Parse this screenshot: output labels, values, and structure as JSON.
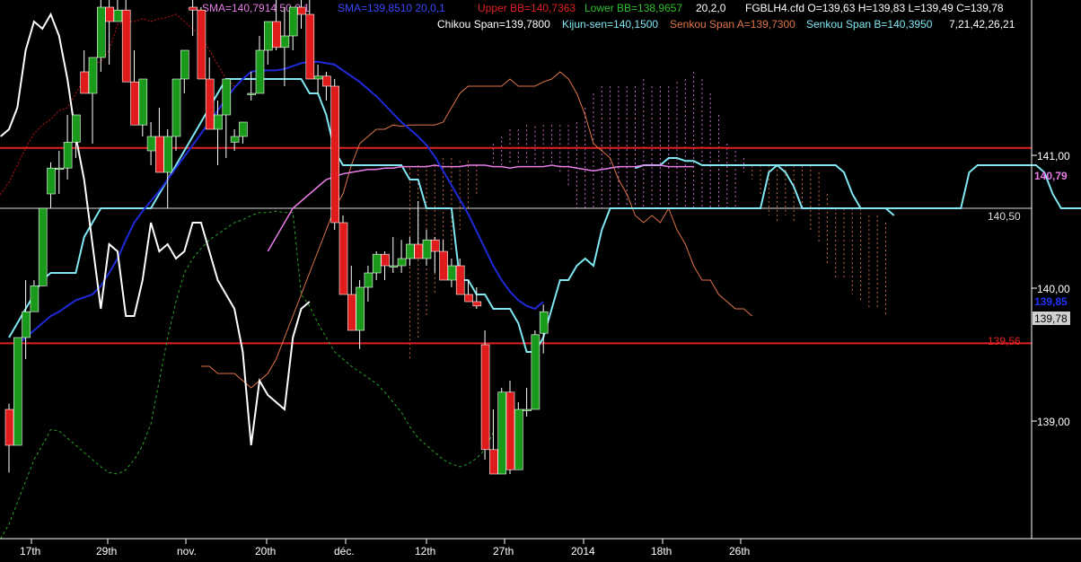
{
  "colors": {
    "background": "#000000",
    "up_candle": "#1a9a1a",
    "down_candle": "#e01b1b",
    "sma50": "#e87de8",
    "sma20": "#1f2ad8",
    "bb_upper": "#c21313",
    "bb_lower": "#2aa52a",
    "chikou": "#ffffff",
    "kijun": "#7fe8f2",
    "senkou_a": "#e0744a",
    "senkou_b": "#7fe8f2",
    "hline_red": "#e32020",
    "hline_white": "#dddddd",
    "axis_text": "#ffffff"
  },
  "header": {
    "sma50_text": "SMA=140,7914  50,0,1",
    "sma20_text": "SMA=139,8510  20,0,1",
    "bb_upper_text": "Upper BB=140,7363",
    "bb_lower_text": "Lower BB=138,9657",
    "bb_params_text": "20,2,0",
    "ohlc_text": "FGBLH4.cfd O=139,63 H=139,83 L=139,49 C=139,78",
    "chikou_text": "Chikou Span=139,7800",
    "kijun_text": "Kijun-sen=140,1500",
    "senkou_a_text": "Senkou Span A=139,7300",
    "senkou_b_text": "Senkou Span B=140,3950",
    "ichimoku_params_text": "7,21,42,26,21"
  },
  "chart_data": {
    "type": "candlestick",
    "ylim": [
      138.2,
      141.95
    ],
    "grid": false,
    "y_ticks": [
      "141,00",
      "140,50",
      "140,00",
      "139,00"
    ],
    "x_ticks": [
      "17th",
      "29th",
      "nov.",
      "20th",
      "déc.",
      "12th",
      "27th",
      "2014",
      "18th",
      "26th"
    ],
    "price_labels": {
      "sma50": "140,79",
      "white_line": "140,50",
      "sma20": "139,85",
      "last_close": "139,78",
      "red_line": "139,56"
    },
    "horizontal_lines": {
      "red_upper": 140.92,
      "white": 140.5,
      "red_lower": 139.56
    },
    "candles": [
      [
        139.1,
        139.14,
        138.66,
        138.85
      ],
      [
        138.85,
        139.6,
        138.85,
        139.6
      ],
      [
        139.6,
        140.0,
        139.45,
        139.78
      ],
      [
        139.78,
        140.0,
        139.78,
        139.96
      ],
      [
        139.96,
        140.5,
        139.96,
        140.5
      ],
      [
        140.6,
        140.82,
        140.5,
        140.78
      ],
      [
        140.78,
        140.9,
        140.6,
        140.78
      ],
      [
        140.78,
        141.15,
        140.7,
        140.96
      ],
      [
        140.96,
        141.15,
        140.85,
        141.15
      ],
      [
        141.45,
        141.6,
        141.3,
        141.3
      ],
      [
        141.3,
        141.5,
        140.95,
        141.55
      ],
      [
        141.55,
        141.95,
        141.45,
        141.9
      ],
      [
        141.9,
        141.98,
        141.5,
        141.8
      ],
      [
        141.8,
        141.95,
        141.8,
        141.88
      ],
      [
        141.88,
        141.95,
        141.38,
        141.38
      ],
      [
        141.38,
        141.6,
        141.08,
        141.08
      ],
      [
        141.08,
        141.4,
        141.0,
        141.4
      ],
      [
        140.9,
        141.1,
        140.8,
        141.0
      ],
      [
        141.0,
        141.2,
        140.75,
        140.75
      ],
      [
        140.75,
        141.05,
        140.5,
        141.0
      ],
      [
        141.0,
        141.4,
        140.9,
        141.4
      ],
      [
        141.4,
        141.6,
        141.3,
        141.6
      ],
      [
        141.9,
        141.95,
        141.7,
        141.88
      ],
      [
        141.88,
        141.9,
        141.4,
        141.4
      ],
      [
        141.4,
        141.55,
        141.05,
        141.05
      ],
      [
        141.05,
        141.25,
        140.8,
        141.15
      ],
      [
        141.15,
        141.4,
        140.85,
        141.4
      ],
      [
        140.96,
        141.05,
        140.9,
        141.0
      ],
      [
        141.0,
        141.1,
        140.95,
        141.1
      ],
      [
        141.3,
        141.45,
        141.25,
        141.3
      ],
      [
        141.3,
        141.7,
        141.3,
        141.6
      ],
      [
        141.6,
        141.8,
        141.5,
        141.8
      ],
      [
        141.8,
        141.95,
        141.6,
        141.62
      ],
      [
        141.62,
        141.9,
        141.35,
        141.7
      ],
      [
        141.7,
        141.9,
        141.6,
        141.9
      ],
      [
        141.9,
        141.95,
        141.75,
        141.85
      ],
      [
        141.85,
        141.95,
        141.4,
        141.4
      ],
      [
        141.4,
        141.5,
        141.3,
        141.42
      ],
      [
        141.42,
        141.45,
        141.25,
        141.35
      ],
      [
        141.35,
        141.4,
        140.35,
        140.4
      ],
      [
        140.4,
        140.45,
        139.9,
        139.9
      ],
      [
        139.9,
        140.1,
        139.65,
        139.65
      ],
      [
        139.65,
        140.0,
        139.52,
        139.95
      ],
      [
        139.95,
        140.1,
        139.85,
        140.05
      ],
      [
        140.05,
        140.2,
        140.0,
        140.18
      ],
      [
        140.18,
        140.2,
        140.0,
        140.1
      ],
      [
        140.1,
        140.3,
        140.05,
        140.1
      ],
      [
        140.1,
        140.28,
        140.05,
        140.15
      ],
      [
        140.15,
        140.3,
        140.1,
        140.25
      ],
      [
        140.25,
        140.55,
        140.15,
        140.15
      ],
      [
        140.15,
        140.35,
        140.1,
        140.28
      ],
      [
        140.28,
        140.3,
        140.05,
        140.2
      ],
      [
        140.2,
        140.28,
        140.0,
        140.0
      ],
      [
        140.0,
        140.15,
        139.95,
        140.1
      ],
      [
        140.1,
        140.15,
        139.9,
        139.9
      ],
      [
        139.9,
        140.0,
        139.85,
        139.85
      ],
      [
        139.85,
        139.95,
        139.8,
        139.82
      ],
      [
        139.55,
        139.65,
        138.75,
        138.82
      ],
      [
        138.82,
        139.1,
        138.65,
        138.65
      ],
      [
        138.65,
        139.25,
        138.65,
        139.22
      ],
      [
        139.22,
        139.3,
        138.65,
        138.68
      ],
      [
        138.68,
        139.15,
        138.68,
        139.1
      ],
      [
        139.1,
        139.25,
        139.05,
        139.1
      ],
      [
        139.1,
        139.65,
        139.1,
        139.62
      ],
      [
        139.63,
        139.83,
        139.49,
        139.78
      ]
    ],
    "series": [
      {
        "key": "chikou",
        "values": [
          141.0,
          141.05,
          141.2,
          141.6,
          141.8,
          141.75,
          141.85,
          141.7,
          141.4,
          141.0,
          140.7,
          140.25,
          139.8,
          140.25,
          140.2,
          139.75,
          139.75,
          140.0,
          140.4,
          140.2,
          140.25,
          140.15,
          140.2,
          140.4,
          140.4,
          140.2,
          140.0,
          139.9,
          139.8,
          139.5,
          138.85,
          139.3,
          139.2,
          139.15,
          139.1,
          139.6,
          139.8,
          139.85
        ]
      },
      {
        "key": "sma50",
        "values": [
          140.2,
          140.3,
          140.4,
          140.5,
          140.55,
          140.6,
          140.65,
          140.7,
          140.72,
          140.74,
          140.75,
          140.76,
          140.77,
          140.77,
          140.78,
          140.78,
          140.79,
          140.79,
          140.79,
          140.79,
          140.8,
          140.79,
          140.79,
          140.79,
          140.8,
          140.8,
          140.8,
          140.79,
          140.79,
          140.78,
          140.79,
          140.79,
          140.79,
          140.79,
          140.8,
          140.79,
          140.79,
          140.78,
          140.77,
          140.76,
          140.77,
          140.78,
          140.79,
          140.79,
          140.79,
          140.8,
          140.8,
          140.8,
          140.79,
          140.79,
          140.79,
          140.79
        ]
      },
      {
        "key": "sma20",
        "values": [
          139.55,
          139.6,
          139.65,
          139.7,
          139.75,
          139.78,
          139.82,
          139.86,
          139.88,
          139.9,
          139.96,
          140.05,
          140.15,
          140.28,
          140.4,
          140.48,
          140.55,
          140.62,
          140.7,
          140.78,
          140.86,
          140.94,
          141.02,
          141.1,
          141.18,
          141.26,
          141.34,
          141.4,
          141.45,
          141.46,
          141.46,
          141.46,
          141.47,
          141.49,
          141.51,
          141.52,
          141.52,
          141.51,
          141.5,
          141.46,
          141.42,
          141.38,
          141.33,
          141.28,
          141.22,
          141.16,
          141.1,
          141.05,
          141.0,
          140.94,
          140.86,
          140.76,
          140.66,
          140.56,
          140.46,
          140.34,
          140.22,
          140.1,
          140.0,
          139.92,
          139.86,
          139.82,
          139.8,
          139.85
        ]
      },
      {
        "key": "bb_upper",
        "values": [
          140.8,
          140.72,
          140.66,
          140.6,
          140.6,
          140.55,
          140.52,
          140.5,
          140.55,
          140.6,
          140.68,
          140.8,
          140.92,
          141.02,
          141.08,
          141.12,
          141.18,
          141.2,
          141.3,
          141.4,
          141.5,
          141.52,
          141.6,
          141.78,
          141.8,
          141.8,
          141.82,
          141.8,
          141.82,
          141.83,
          141.85,
          141.8,
          141.75,
          141.7,
          141.6,
          141.5,
          141.4,
          141.35
        ]
      },
      {
        "key": "bb_lower",
        "values": [
          138.2,
          138.3,
          138.45,
          138.6,
          138.75,
          138.85,
          138.96,
          138.95,
          138.9,
          138.85,
          138.8,
          138.75,
          138.7,
          138.66,
          138.65,
          138.68,
          138.75,
          138.85,
          139.0,
          139.3,
          139.6,
          139.85,
          140.05,
          140.15,
          140.22,
          140.28,
          140.32,
          140.36,
          140.4,
          140.42,
          140.45,
          140.47,
          140.47,
          140.48,
          140.47,
          140.47,
          139.9,
          139.82,
          139.7,
          139.6,
          139.5,
          139.45,
          139.4,
          139.36,
          139.32,
          139.28,
          139.22,
          139.15,
          139.08,
          138.98,
          138.9,
          138.85,
          138.8,
          138.75,
          138.72,
          138.7,
          138.72,
          138.76,
          138.82,
          138.94
        ]
      },
      {
        "key": "kijun",
        "values": [
          139.6,
          139.7,
          139.8,
          139.9,
          140.0,
          140.05,
          140.05,
          140.05,
          140.05,
          140.3,
          140.4,
          140.5,
          140.5,
          140.5,
          140.5,
          140.5,
          140.5,
          140.5,
          140.6,
          140.7,
          140.8,
          140.9,
          141.0,
          141.1,
          141.2,
          141.3,
          141.4,
          141.4,
          141.4,
          141.4,
          141.4,
          141.4,
          141.4,
          141.4,
          141.4,
          141.4,
          141.3,
          141.3,
          141.15,
          140.9,
          140.8,
          140.8,
          140.8,
          140.8,
          140.8,
          140.8,
          140.8,
          140.8,
          140.7,
          140.7,
          140.5,
          140.5,
          140.5,
          140.5,
          140.0,
          140.0,
          139.9,
          139.9,
          139.8,
          139.8,
          139.8,
          139.7,
          139.5,
          139.5,
          139.6,
          139.8,
          140.0,
          140.0,
          140.1,
          140.15,
          140.1,
          140.35,
          140.5,
          140.5,
          140.5,
          140.5,
          140.5,
          140.5,
          140.5,
          140.5,
          140.5,
          140.5,
          140.5,
          140.5,
          140.5,
          140.5,
          140.5,
          140.5,
          140.5,
          140.5,
          140.5,
          140.75,
          140.8,
          140.8,
          140.8,
          140.8,
          140.8,
          140.8,
          140.8,
          140.8,
          140.75,
          140.6,
          140.5,
          140.5,
          140.5,
          140.5,
          140.45
        ]
      },
      {
        "key": "senkou_a",
        "values": [
          139.4,
          139.4,
          139.35,
          139.35,
          139.35,
          139.3,
          139.25,
          139.3,
          139.35,
          139.45,
          139.6,
          139.75,
          139.9,
          140.05,
          140.2,
          140.35,
          140.5,
          140.6,
          140.8,
          140.95,
          141.0,
          141.05,
          141.05,
          141.08,
          141.07,
          141.08,
          141.08,
          141.08,
          141.08,
          141.1,
          141.2,
          141.3,
          141.35,
          141.35,
          141.35,
          141.35,
          141.35,
          141.4,
          141.35,
          141.35,
          141.35,
          141.38,
          141.4,
          141.45,
          141.4,
          141.3,
          141.15,
          140.95,
          140.9,
          140.85,
          140.7,
          140.6,
          140.45,
          140.4,
          140.45,
          140.4,
          140.5,
          140.35,
          140.25,
          140.1,
          140.0,
          140.0,
          139.9,
          139.85,
          139.8,
          139.8,
          139.75
        ]
      },
      {
        "key": "senkou_b",
        "values": [
          140.78,
          140.8,
          140.8,
          140.8,
          140.85,
          140.85,
          140.83,
          140.83,
          140.8,
          140.8,
          140.8,
          140.8,
          140.8,
          140.8,
          140.8,
          140.8,
          140.8,
          140.8,
          140.75,
          140.65,
          140.5,
          140.5,
          140.5,
          140.5,
          140.5,
          140.5,
          140.5,
          140.5,
          140.5,
          140.5,
          140.5,
          140.5,
          140.5,
          140.5,
          140.5,
          140.5,
          140.5,
          140.5,
          140.5,
          140.5,
          140.75,
          140.8,
          140.8,
          140.8,
          140.8,
          140.8,
          140.8,
          140.8,
          140.8,
          140.75,
          140.6,
          140.5,
          140.5,
          140.5,
          140.5,
          140.45,
          140.45,
          140.4
        ]
      }
    ]
  }
}
